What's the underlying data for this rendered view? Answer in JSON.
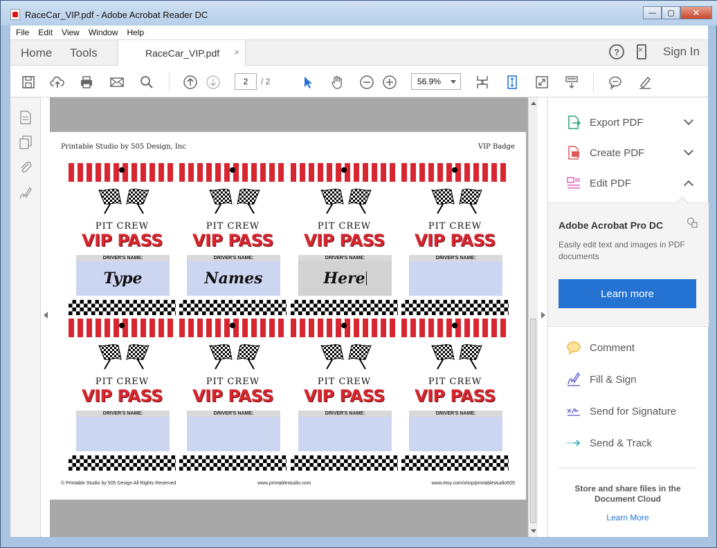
{
  "window": {
    "title": "RaceCar_VIP.pdf - Adobe Acrobat Reader DC",
    "min": "—",
    "max": "▢",
    "close": "✕"
  },
  "menu": [
    "File",
    "Edit",
    "View",
    "Window",
    "Help"
  ],
  "tabs": {
    "home": "Home",
    "tools": "Tools",
    "doc": "RaceCar_VIP.pdf",
    "close": "×",
    "help": "?",
    "signin": "Sign In"
  },
  "toolbar": {
    "page_current": "2",
    "page_total": "/ 2",
    "zoom": "56.9%"
  },
  "document": {
    "header_left": "Printable Studio by 505 Design, Inc",
    "header_right": "VIP Badge",
    "footer_left": "© Printable Studio by 505 Design All Rights Reserved",
    "footer_center": "www.printablestudio.com",
    "footer_right": "www.etsy.com/shop/printablestudio505",
    "badge": {
      "pit_crew": "PIT CREW",
      "vip_pass": "VIP PASS",
      "drivers_name": "DRIVER'S NAME:"
    },
    "field_values": [
      "Type",
      "Names",
      "Here",
      "",
      "",
      "",
      "",
      ""
    ]
  },
  "rightpane": {
    "export": "Export PDF",
    "create": "Create PDF",
    "edit": "Edit PDF",
    "promo_title": "Adobe Acrobat Pro DC",
    "promo_desc": "Easily edit text and images in PDF documents",
    "learn_more_button": "Learn more",
    "comment": "Comment",
    "fill_sign": "Fill & Sign",
    "send_signature": "Send for Signature",
    "send_track": "Send & Track",
    "cloud_text": "Store and share files in the Document Cloud",
    "cloud_link": "Learn More"
  },
  "colors": {
    "accent_blue": "#2473d2",
    "badge_red": "#d7262f",
    "field_blue": "#cdd6f1"
  }
}
